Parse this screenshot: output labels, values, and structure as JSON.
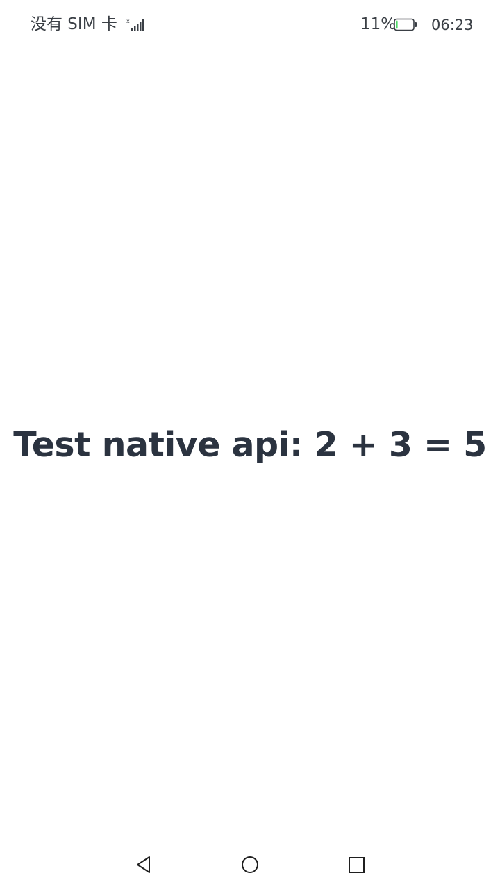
{
  "status_bar": {
    "carrier": "没有 SIM 卡",
    "battery_percent": "11%",
    "battery_level": 0.11,
    "time": "06:23",
    "icons": [
      "signal-icon",
      "battery-icon"
    ]
  },
  "main": {
    "result_text": "Test native api: 2 + 3 = 5"
  },
  "nav_bar": {
    "icons": [
      "back-icon",
      "home-icon",
      "recents-icon"
    ]
  },
  "colors": {
    "text": "#2b3340",
    "battery_fill": "#4cd964",
    "background": "#ffffff"
  }
}
